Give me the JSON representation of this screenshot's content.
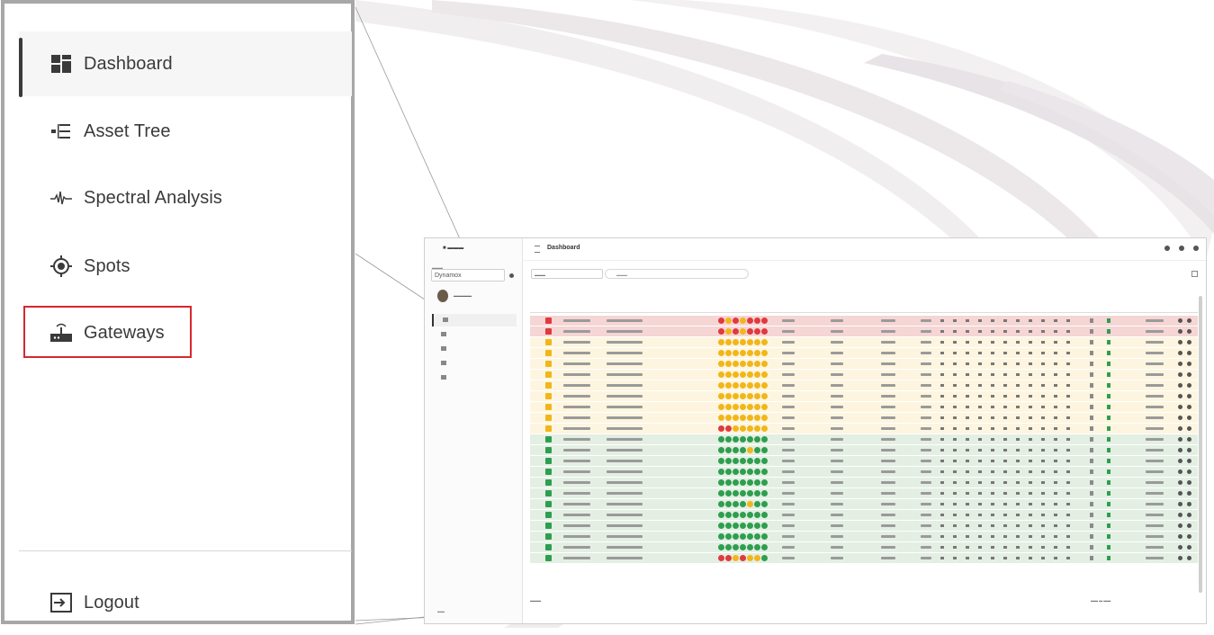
{
  "sidebar_zoom": {
    "items": [
      {
        "label": "Dashboard",
        "icon": "dashboard-icon",
        "active": true
      },
      {
        "label": "Asset Tree",
        "icon": "tree-list-icon"
      },
      {
        "label": "Spectral Analysis",
        "icon": "waveform-icon"
      },
      {
        "label": "Spots",
        "icon": "target-icon"
      },
      {
        "label": "Gateways",
        "icon": "gateway-router-icon",
        "highlighted": true
      }
    ],
    "logout_label": "Logout",
    "logout_icon": "logout-icon",
    "highlight_color": "#d5282d"
  },
  "screenshot": {
    "header_title": "Dashboard",
    "org_select": "Dynamox",
    "status_colors": {
      "red": "#e0393e",
      "yellow": "#f2b619",
      "green": "#2e9e4f"
    },
    "row_backgrounds": {
      "red": "#f6d5d5",
      "yellow": "#fdf5df",
      "green": "#e3efe3"
    }
  }
}
